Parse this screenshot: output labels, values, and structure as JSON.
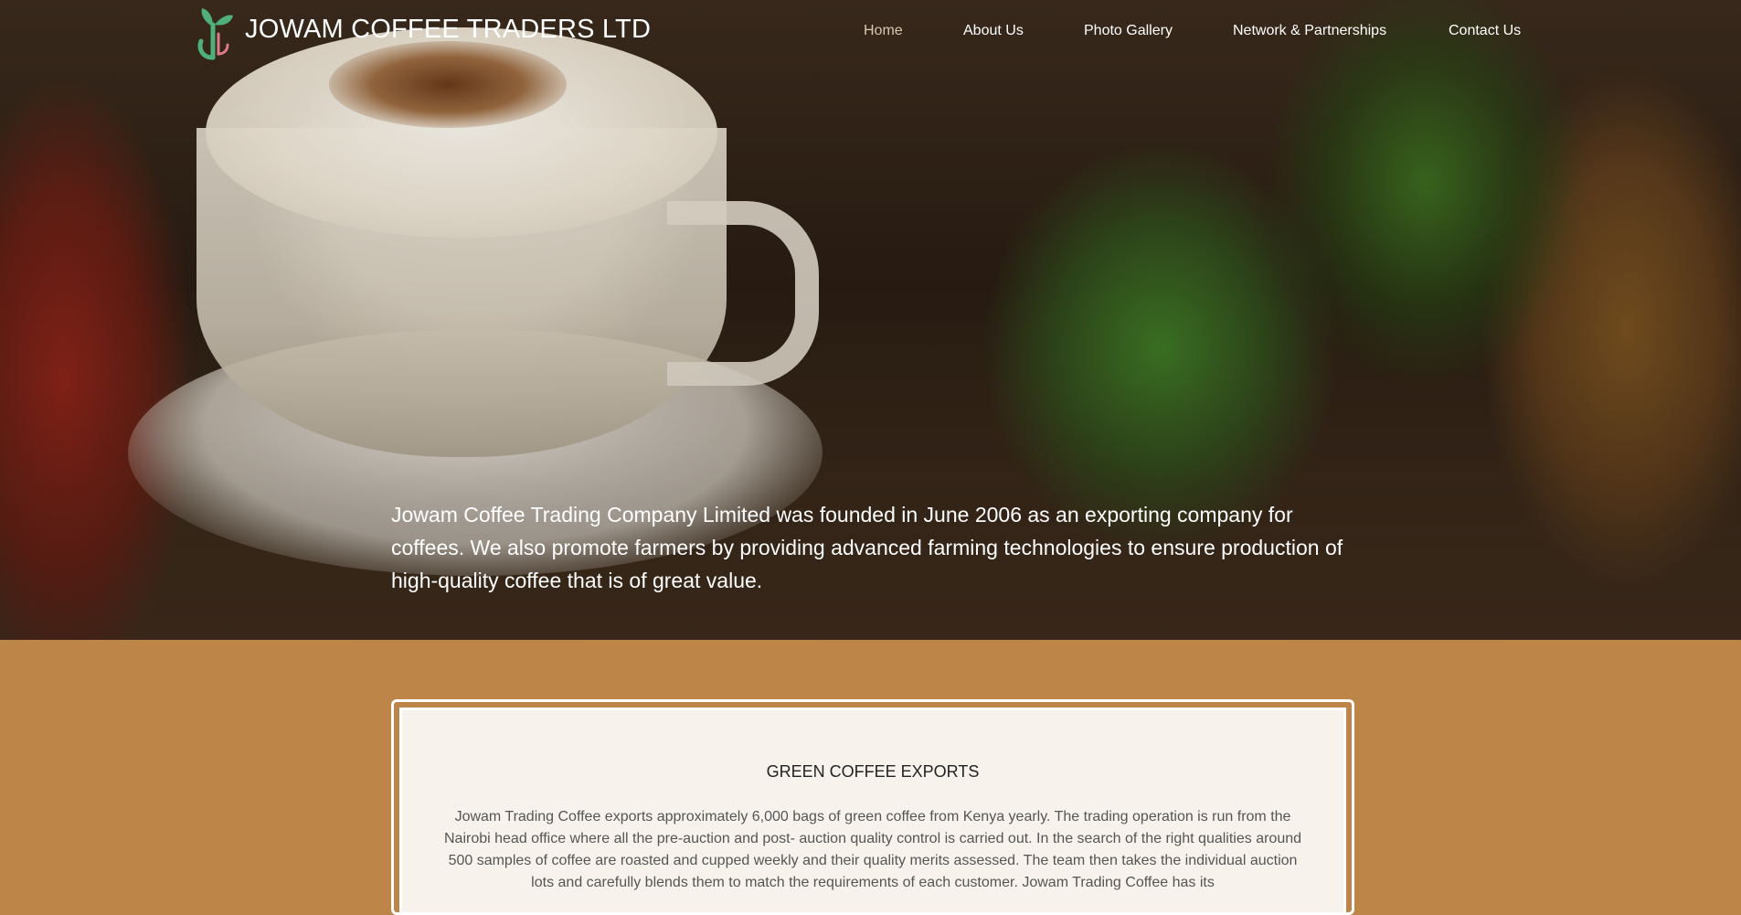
{
  "header": {
    "brand": "JOWAM COFFEE TRADERS LTD",
    "logo_icon": "coffee-plant-logo-icon"
  },
  "nav": {
    "items": [
      {
        "label": "Home",
        "active": true
      },
      {
        "label": "About Us",
        "active": false
      },
      {
        "label": "Photo Gallery",
        "active": false
      },
      {
        "label": "Network & Partnerships",
        "active": false
      },
      {
        "label": "Contact Us",
        "active": false
      }
    ]
  },
  "hero": {
    "text": "Jowam Coffee Trading Company Limited was founded in June 2006 as an exporting company for coffees. We also promote farmers by providing advanced farming technologies to ensure production of high-quality coffee that is of great value."
  },
  "section": {
    "title": "GREEN COFFEE EXPORTS",
    "body": "Jowam Trading Coffee exports approximately 6,000 bags of green coffee from Kenya yearly. The trading operation is run from the Nairobi head office where all the pre-auction and post- auction quality control is carried out. In the search of the right qualities around 500 samples of coffee are roasted and cupped weekly and their quality merits assessed. The team then takes the individual auction lots and carefully blends them to match the requirements of each customer. Jowam Trading Coffee has its"
  },
  "colors": {
    "accent": "#bd8547",
    "card_background": "#f7f3ec",
    "logo_green": "#4fb07a"
  }
}
